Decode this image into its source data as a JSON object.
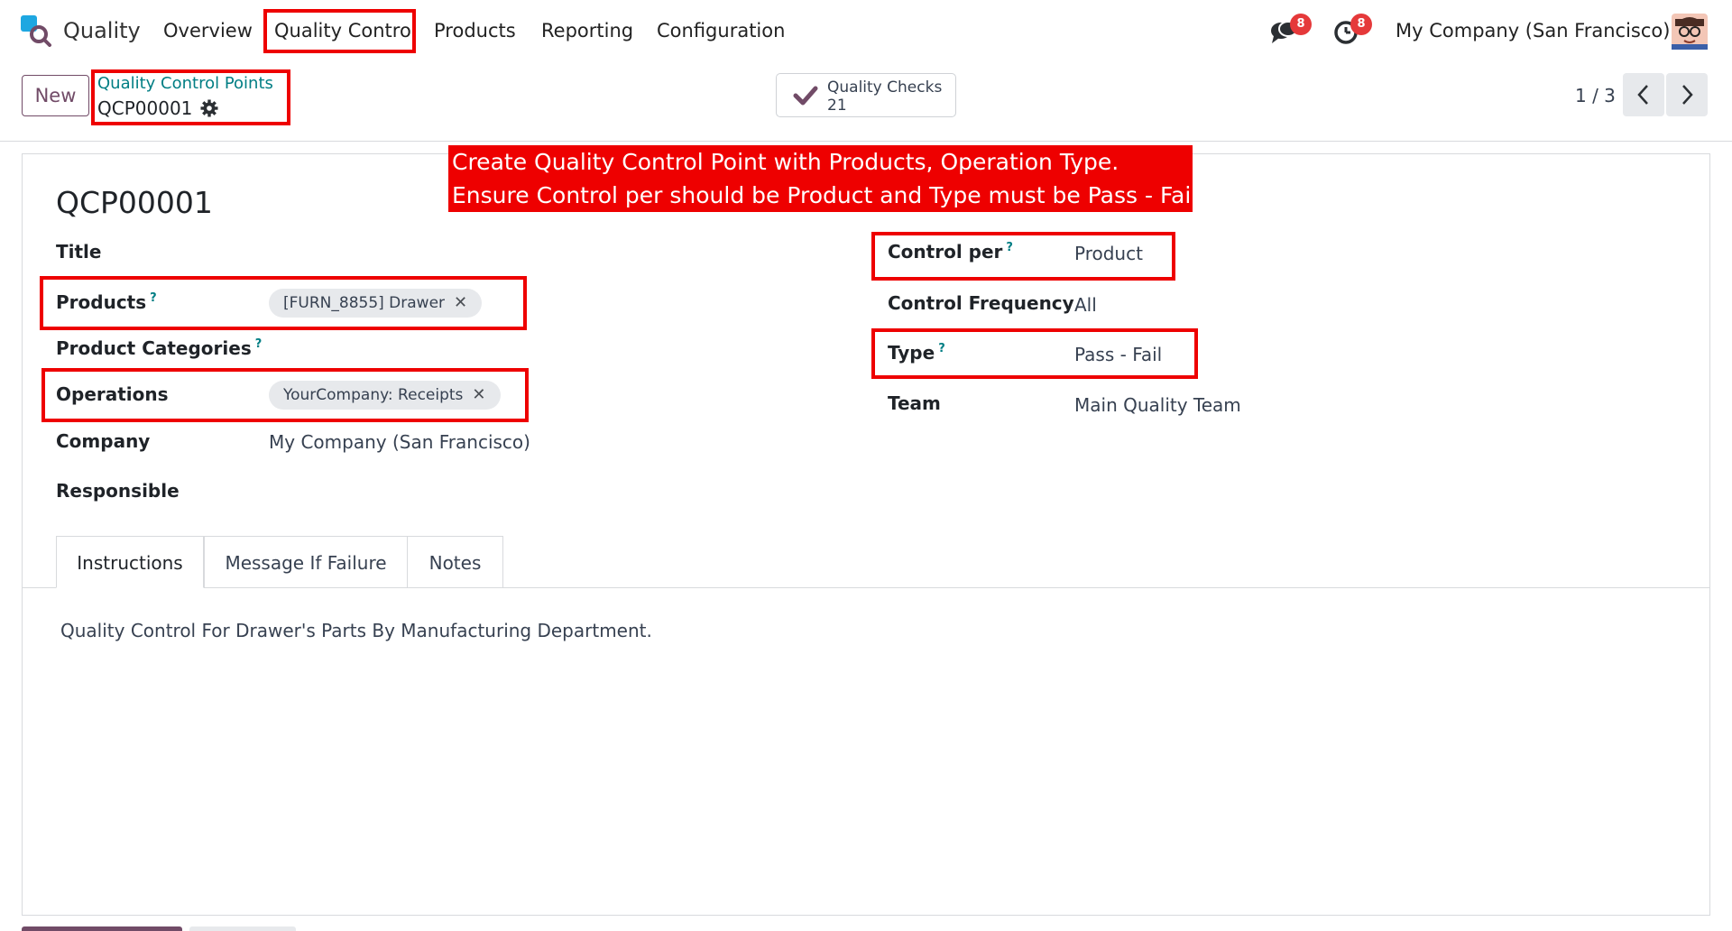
{
  "navbar": {
    "app_name": "Quality",
    "menu": [
      "Overview",
      "Quality Control",
      "Products",
      "Reporting",
      "Configuration"
    ],
    "messages_count": "8",
    "activities_count": "8",
    "company": "My Company (San Francisco)"
  },
  "control_panel": {
    "new_label": "New",
    "breadcrumb_parent": "Quality Control Points",
    "breadcrumb_current": "QCP00001",
    "smart_button": {
      "label": "Quality Checks",
      "count": "21"
    },
    "pager": "1 / 3"
  },
  "annotation": {
    "line1": "Create Quality Control Point with Products, Operation Type.",
    "line2": "Ensure Control per should be Product and Type must be Pass - Fail"
  },
  "form": {
    "reference": "QCP00001",
    "left": {
      "title_label": "Title",
      "products_label": "Products",
      "products_tag": "[FURN_8855] Drawer",
      "product_categories_label": "Product Categories",
      "operations_label": "Operations",
      "operations_tag": "YourCompany: Receipts",
      "company_label": "Company",
      "company_value": "My Company (San Francisco)",
      "responsible_label": "Responsible"
    },
    "right": {
      "control_per_label": "Control per",
      "control_per_value": "Product",
      "control_frequency_label": "Control Frequency",
      "control_frequency_value": "All",
      "type_label": "Type",
      "type_value": "Pass - Fail",
      "team_label": "Team",
      "team_value": "Main Quality Team"
    },
    "tabs": [
      "Instructions",
      "Message If Failure",
      "Notes"
    ],
    "instructions_text": "Quality Control For Drawer's Parts By Manufacturing Department."
  },
  "colors": {
    "brand": "#714b67",
    "link": "#017e84",
    "highlight": "#ee0000"
  }
}
